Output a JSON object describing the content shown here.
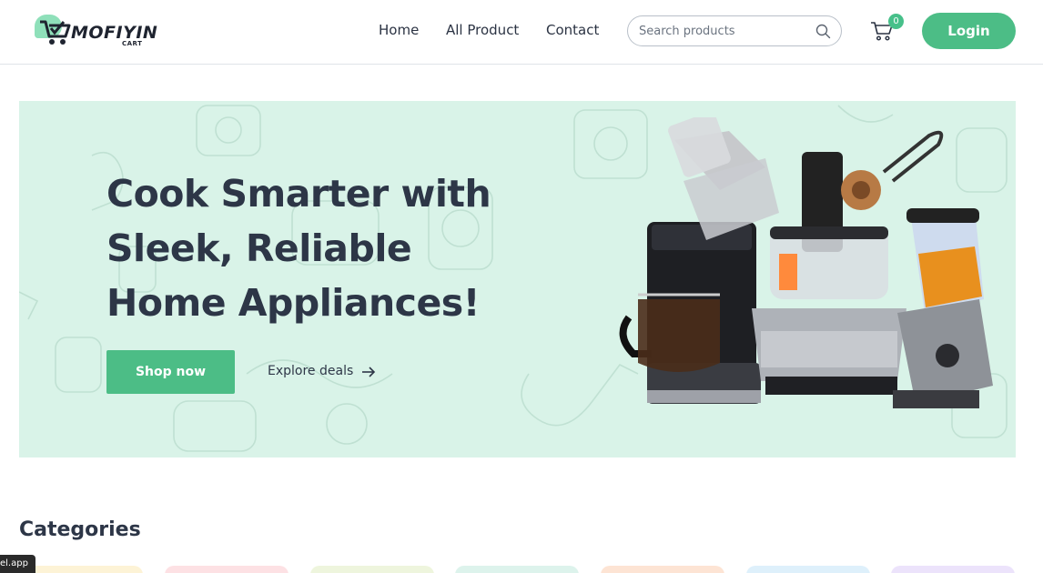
{
  "brand": {
    "name": "MOFIYIN",
    "sub": "CART",
    "accent": "#4cbd86"
  },
  "nav": {
    "home": "Home",
    "all_product": "All Product",
    "contact": "Contact"
  },
  "search": {
    "placeholder": "Search products",
    "icon": "search-icon"
  },
  "cart": {
    "count": "0",
    "icon": "cart-icon"
  },
  "login": {
    "label": "Login"
  },
  "hero": {
    "line1": "Cook Smarter with",
    "line2": "Sleek, Reliable",
    "line3": "Home Appliances!",
    "shop_now": "Shop now",
    "explore": "Explore deals",
    "explore_icon": "arrow-right-icon",
    "background": "#d9f3e8"
  },
  "categories": {
    "title": "Categories",
    "card_colors": [
      "#fdf3d6",
      "#fde1e4",
      "#eef5dd",
      "#ddf3ec",
      "#fde4d4",
      "#def0fb",
      "#ece3fb"
    ]
  },
  "tooltip": "el.app"
}
